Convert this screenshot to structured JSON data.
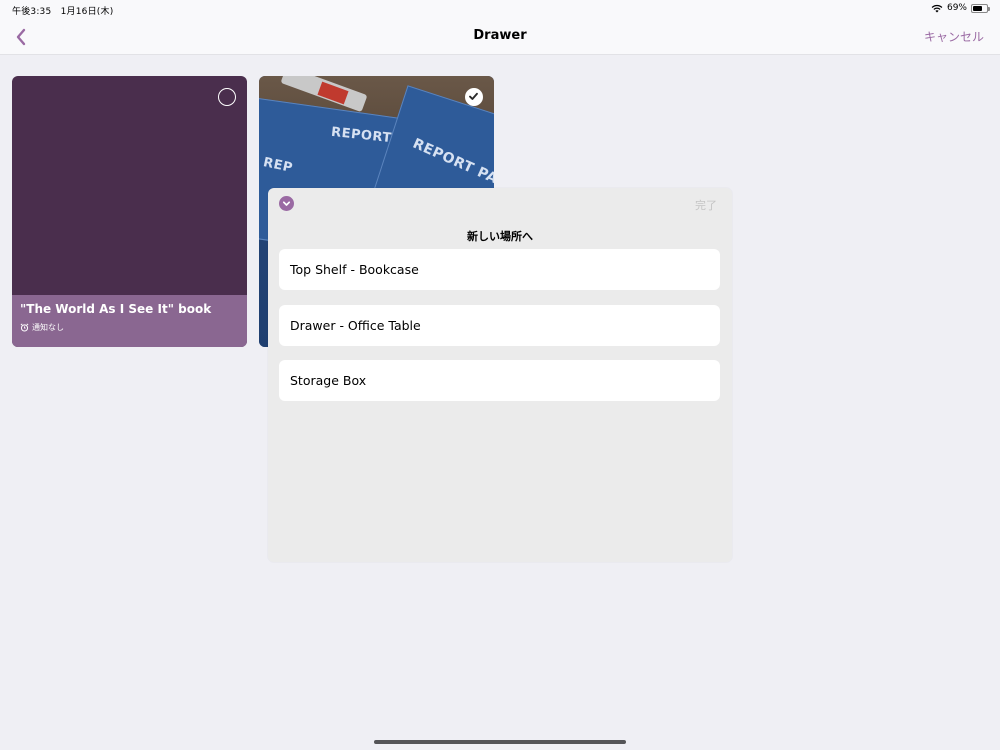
{
  "status": {
    "time": "午後3:35",
    "date": "1月16日(木)",
    "battery_text": "69%",
    "battery_level": 0.69
  },
  "nav": {
    "title": "Drawer",
    "cancel_label": "キャンセル",
    "back_icon": "chevron-left-icon"
  },
  "cards": [
    {
      "title": "\"The World As I See It\" book",
      "subtitle": "通知なし",
      "selected": false,
      "color": "#4a2e4d"
    },
    {
      "photo_text": [
        "REPORT",
        "REPORT PAD",
        "REP"
      ],
      "selected": true
    }
  ],
  "sheet": {
    "done_label": "完了",
    "title": "新しい場所へ",
    "locations": [
      {
        "label": "Top Shelf - Bookcase"
      },
      {
        "label": "Drawer - Office Table"
      },
      {
        "label": "Storage Box"
      }
    ]
  },
  "colors": {
    "accent": "#9a6aa3",
    "background": "#efeff4",
    "card_footer": "#8a6791"
  }
}
